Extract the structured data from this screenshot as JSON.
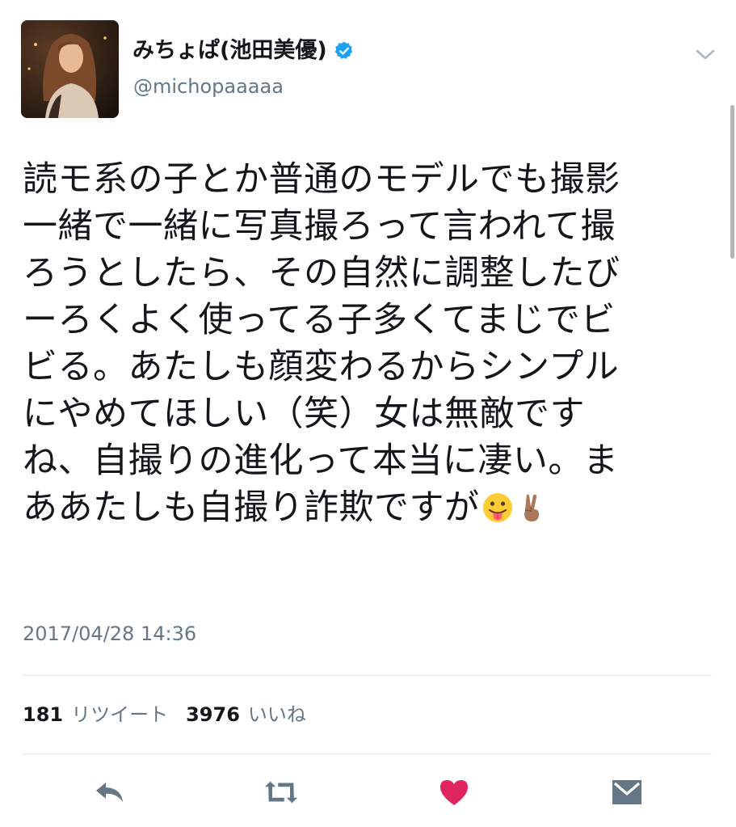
{
  "user": {
    "display_name": "みちょぱ(池田美優)",
    "handle": "@michopaaaaa",
    "verified": true
  },
  "tweet": {
    "lines": [
      "読モ系の子とか普通のモデルでも撮影",
      "一緒で一緒に写真撮ろって言われて撮",
      "ろうとしたら、その自然に調整したび",
      "ーろくよく使ってる子多くてまじでビ",
      "ビる。あたしも顔変わるからシンプル",
      "にやめてほしい（笑）女は無敵です",
      "ね、自撮りの進化って本当に凄い。ま",
      "ああたしも自撮り詐欺ですが"
    ],
    "emojis": [
      "tongue-face-emoji",
      "victory-hand-emoji"
    ],
    "timestamp": "2017/04/28 14:36"
  },
  "stats": {
    "retweets_count": "181",
    "retweets_label": "リツイート",
    "likes_count": "3976",
    "likes_label": "いいね"
  },
  "actions": [
    "reply-icon",
    "retweet-icon",
    "like-icon",
    "direct-message-icon"
  ],
  "colors": {
    "text": "#14171a",
    "secondary": "#657786",
    "verified": "#1da1f2",
    "like": "#e0245e",
    "action": "#657786",
    "divider": "#e1e8ed"
  }
}
